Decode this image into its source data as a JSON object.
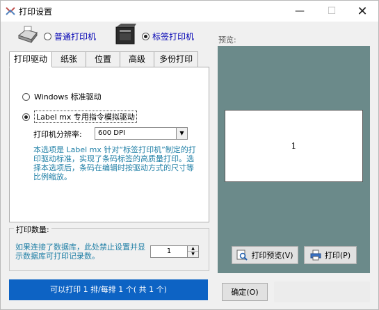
{
  "window": {
    "title": "打印设置",
    "title_icon": "app-settings-icon"
  },
  "printer_type": {
    "normal_label": "普通打印机",
    "label_label": "标签打印机",
    "selected": "label"
  },
  "tabs": [
    {
      "label": "打印驱动",
      "active": true
    },
    {
      "label": "纸张",
      "active": false
    },
    {
      "label": "位置",
      "active": false
    },
    {
      "label": "高级",
      "active": false
    },
    {
      "label": "多份打印",
      "active": false
    }
  ],
  "driver": {
    "option_windows": "Windows 标准驱动",
    "option_labelmx": "Label mx 专用指令模拟驱动",
    "selected": "labelmx",
    "resolution_label": "打印机分辨率:",
    "resolution_value": "600 DPI",
    "note": "本选项是 Label mx 针对“标签打印机”制定的打印驱动标准，实现了条码标签的高质量打印。选择本选项后，条码在编辑时按驱动方式的尺寸等比例缩放。"
  },
  "print_count": {
    "group_title": "打印数量:",
    "note": "如果连接了数据库，此处禁止设置并显示数据库可打印记录数。",
    "value": "1"
  },
  "status": {
    "text": "可以打印 1 排/每排 1 个( 共 1 个)"
  },
  "preview": {
    "label": "预览:",
    "page_number": "1",
    "preview_button": "打印预览(V)",
    "print_button": "打印(P)"
  },
  "footer": {
    "ok_button": "确定(O)"
  },
  "colors": {
    "status_bg": "#0d63c4",
    "preview_bg": "#6b8a8a",
    "note_text": "#1f7fa6",
    "radio_text": "#0000b4"
  }
}
